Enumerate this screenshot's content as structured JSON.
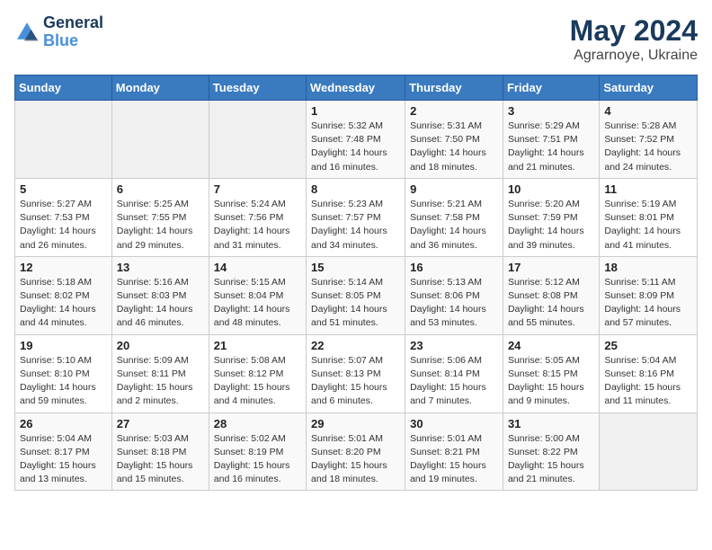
{
  "header": {
    "logo_line1": "General",
    "logo_line2": "Blue",
    "month": "May 2024",
    "location": "Agrarnoye, Ukraine"
  },
  "weekdays": [
    "Sunday",
    "Monday",
    "Tuesday",
    "Wednesday",
    "Thursday",
    "Friday",
    "Saturday"
  ],
  "weeks": [
    [
      {
        "day": "",
        "info": ""
      },
      {
        "day": "",
        "info": ""
      },
      {
        "day": "",
        "info": ""
      },
      {
        "day": "1",
        "info": "Sunrise: 5:32 AM\nSunset: 7:48 PM\nDaylight: 14 hours\nand 16 minutes."
      },
      {
        "day": "2",
        "info": "Sunrise: 5:31 AM\nSunset: 7:50 PM\nDaylight: 14 hours\nand 18 minutes."
      },
      {
        "day": "3",
        "info": "Sunrise: 5:29 AM\nSunset: 7:51 PM\nDaylight: 14 hours\nand 21 minutes."
      },
      {
        "day": "4",
        "info": "Sunrise: 5:28 AM\nSunset: 7:52 PM\nDaylight: 14 hours\nand 24 minutes."
      }
    ],
    [
      {
        "day": "5",
        "info": "Sunrise: 5:27 AM\nSunset: 7:53 PM\nDaylight: 14 hours\nand 26 minutes."
      },
      {
        "day": "6",
        "info": "Sunrise: 5:25 AM\nSunset: 7:55 PM\nDaylight: 14 hours\nand 29 minutes."
      },
      {
        "day": "7",
        "info": "Sunrise: 5:24 AM\nSunset: 7:56 PM\nDaylight: 14 hours\nand 31 minutes."
      },
      {
        "day": "8",
        "info": "Sunrise: 5:23 AM\nSunset: 7:57 PM\nDaylight: 14 hours\nand 34 minutes."
      },
      {
        "day": "9",
        "info": "Sunrise: 5:21 AM\nSunset: 7:58 PM\nDaylight: 14 hours\nand 36 minutes."
      },
      {
        "day": "10",
        "info": "Sunrise: 5:20 AM\nSunset: 7:59 PM\nDaylight: 14 hours\nand 39 minutes."
      },
      {
        "day": "11",
        "info": "Sunrise: 5:19 AM\nSunset: 8:01 PM\nDaylight: 14 hours\nand 41 minutes."
      }
    ],
    [
      {
        "day": "12",
        "info": "Sunrise: 5:18 AM\nSunset: 8:02 PM\nDaylight: 14 hours\nand 44 minutes."
      },
      {
        "day": "13",
        "info": "Sunrise: 5:16 AM\nSunset: 8:03 PM\nDaylight: 14 hours\nand 46 minutes."
      },
      {
        "day": "14",
        "info": "Sunrise: 5:15 AM\nSunset: 8:04 PM\nDaylight: 14 hours\nand 48 minutes."
      },
      {
        "day": "15",
        "info": "Sunrise: 5:14 AM\nSunset: 8:05 PM\nDaylight: 14 hours\nand 51 minutes."
      },
      {
        "day": "16",
        "info": "Sunrise: 5:13 AM\nSunset: 8:06 PM\nDaylight: 14 hours\nand 53 minutes."
      },
      {
        "day": "17",
        "info": "Sunrise: 5:12 AM\nSunset: 8:08 PM\nDaylight: 14 hours\nand 55 minutes."
      },
      {
        "day": "18",
        "info": "Sunrise: 5:11 AM\nSunset: 8:09 PM\nDaylight: 14 hours\nand 57 minutes."
      }
    ],
    [
      {
        "day": "19",
        "info": "Sunrise: 5:10 AM\nSunset: 8:10 PM\nDaylight: 14 hours\nand 59 minutes."
      },
      {
        "day": "20",
        "info": "Sunrise: 5:09 AM\nSunset: 8:11 PM\nDaylight: 15 hours\nand 2 minutes."
      },
      {
        "day": "21",
        "info": "Sunrise: 5:08 AM\nSunset: 8:12 PM\nDaylight: 15 hours\nand 4 minutes."
      },
      {
        "day": "22",
        "info": "Sunrise: 5:07 AM\nSunset: 8:13 PM\nDaylight: 15 hours\nand 6 minutes."
      },
      {
        "day": "23",
        "info": "Sunrise: 5:06 AM\nSunset: 8:14 PM\nDaylight: 15 hours\nand 7 minutes."
      },
      {
        "day": "24",
        "info": "Sunrise: 5:05 AM\nSunset: 8:15 PM\nDaylight: 15 hours\nand 9 minutes."
      },
      {
        "day": "25",
        "info": "Sunrise: 5:04 AM\nSunset: 8:16 PM\nDaylight: 15 hours\nand 11 minutes."
      }
    ],
    [
      {
        "day": "26",
        "info": "Sunrise: 5:04 AM\nSunset: 8:17 PM\nDaylight: 15 hours\nand 13 minutes."
      },
      {
        "day": "27",
        "info": "Sunrise: 5:03 AM\nSunset: 8:18 PM\nDaylight: 15 hours\nand 15 minutes."
      },
      {
        "day": "28",
        "info": "Sunrise: 5:02 AM\nSunset: 8:19 PM\nDaylight: 15 hours\nand 16 minutes."
      },
      {
        "day": "29",
        "info": "Sunrise: 5:01 AM\nSunset: 8:20 PM\nDaylight: 15 hours\nand 18 minutes."
      },
      {
        "day": "30",
        "info": "Sunrise: 5:01 AM\nSunset: 8:21 PM\nDaylight: 15 hours\nand 19 minutes."
      },
      {
        "day": "31",
        "info": "Sunrise: 5:00 AM\nSunset: 8:22 PM\nDaylight: 15 hours\nand 21 minutes."
      },
      {
        "day": "",
        "info": ""
      }
    ]
  ]
}
